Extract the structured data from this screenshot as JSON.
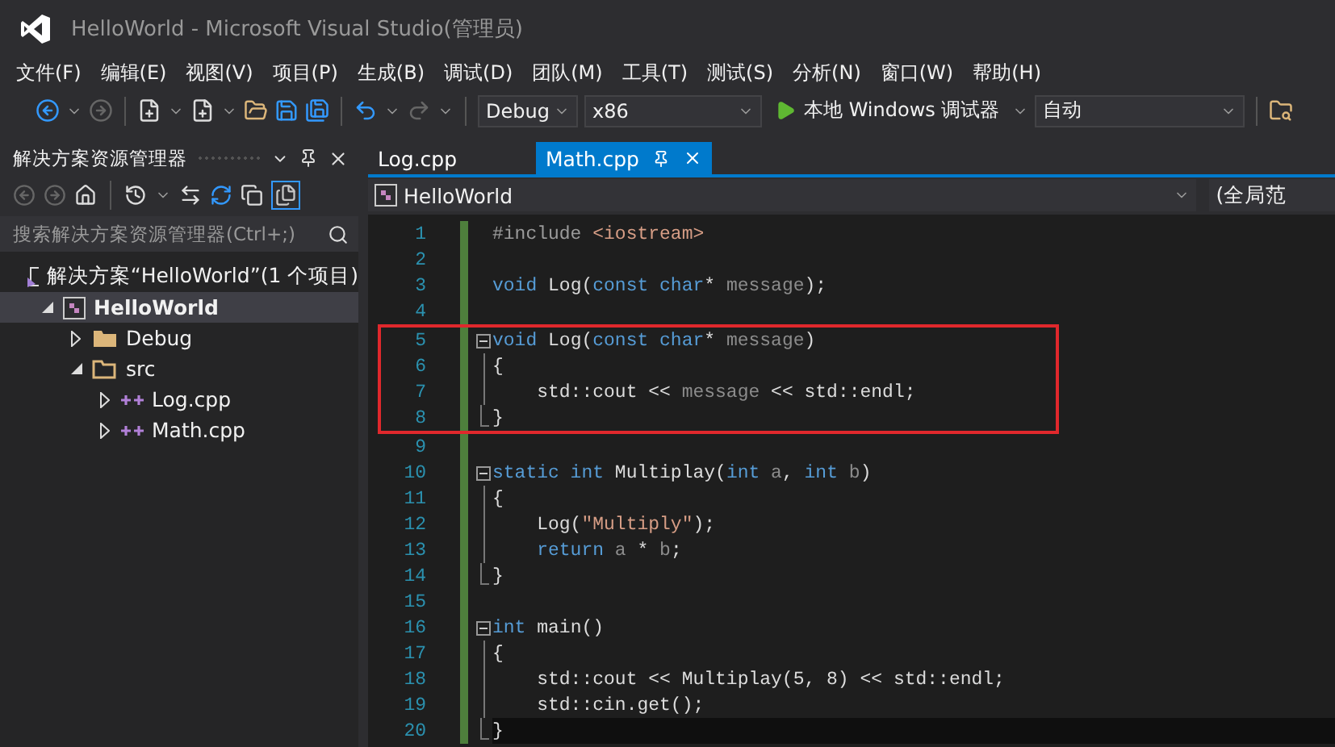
{
  "window": {
    "title": "HelloWorld - Microsoft Visual Studio(管理员)"
  },
  "menu": [
    "文件(F)",
    "编辑(E)",
    "视图(V)",
    "项目(P)",
    "生成(B)",
    "调试(D)",
    "团队(M)",
    "工具(T)",
    "测试(S)",
    "分析(N)",
    "窗口(W)",
    "帮助(H)"
  ],
  "toolbar": {
    "configuration": "Debug",
    "platform": "x86",
    "run_button": "本地 Windows 调试器",
    "mode": "自动"
  },
  "solution_explorer": {
    "title": "解决方案资源管理器",
    "search": {
      "placeholder": "搜索解决方案资源管理器(Ctrl+;)"
    },
    "tree": [
      {
        "label": "解决方案“HelloWorld”(1 个项目)",
        "kind": "solution",
        "selected": false,
        "children": [
          {
            "label": "HelloWorld",
            "kind": "project",
            "expanded": true,
            "selected": true,
            "children": [
              {
                "label": "Debug",
                "kind": "folder",
                "expanded": false,
                "selected": false
              },
              {
                "label": "src",
                "kind": "folder",
                "expanded": true,
                "selected": false,
                "children": [
                  {
                    "label": "Log.cpp",
                    "kind": "file",
                    "expanded": false,
                    "selected": false
                  },
                  {
                    "label": "Math.cpp",
                    "kind": "file",
                    "expanded": false,
                    "selected": false
                  }
                ]
              }
            ]
          }
        ]
      }
    ]
  },
  "tabs": [
    {
      "label": "Log.cpp",
      "selected": false
    },
    {
      "label": "Math.cpp",
      "selected": true
    }
  ],
  "nav_bar": {
    "project": "HelloWorld",
    "scope": "(全局范"
  },
  "editor": {
    "lines": [
      {
        "number": "1",
        "highlight": false,
        "current": false,
        "tokens": [
          {
            "text": "#include ",
            "kind": "directive"
          },
          {
            "text": "<iostream>",
            "kind": "string"
          }
        ]
      },
      {
        "number": "2",
        "highlight": false,
        "current": false
      },
      {
        "number": "3",
        "highlight": false,
        "current": false,
        "tokens": [
          {
            "text": "void",
            "kind": "keyword"
          },
          {
            "text": " Log(",
            "kind": "plain"
          },
          {
            "text": "const char",
            "kind": "keyword"
          },
          {
            "text": "* ",
            "kind": "plain"
          },
          {
            "text": "message",
            "kind": "param"
          },
          {
            "text": ");",
            "kind": "plain"
          }
        ]
      },
      {
        "number": "4",
        "highlight": false,
        "current": false
      },
      {
        "number": "5",
        "fold": {
          "kind": "open"
        },
        "highlight": true,
        "current": false,
        "tokens": [
          {
            "text": "void",
            "kind": "keyword"
          },
          {
            "text": " Log(",
            "kind": "plain"
          },
          {
            "text": "const char",
            "kind": "keyword"
          },
          {
            "text": "* ",
            "kind": "plain"
          },
          {
            "text": "message",
            "kind": "param"
          },
          {
            "text": ")",
            "kind": "plain"
          }
        ]
      },
      {
        "number": "6",
        "fold": {
          "kind": "inner"
        },
        "highlight": true,
        "current": false,
        "tokens": [
          {
            "text": "{",
            "kind": "plain"
          }
        ]
      },
      {
        "number": "7",
        "fold": {
          "kind": "inner"
        },
        "highlight": true,
        "current": false,
        "tokens": [
          {
            "text": "    std::cout << ",
            "kind": "plain"
          },
          {
            "text": "message",
            "kind": "param"
          },
          {
            "text": " << std::endl;",
            "kind": "plain"
          }
        ]
      },
      {
        "number": "8",
        "fold": {
          "kind": "close"
        },
        "highlight": true,
        "current": false,
        "tokens": [
          {
            "text": "}",
            "kind": "plain"
          }
        ]
      },
      {
        "number": "9",
        "highlight": false,
        "current": false
      },
      {
        "number": "10",
        "fold": {
          "kind": "open"
        },
        "highlight": false,
        "current": false,
        "tokens": [
          {
            "text": "static int",
            "kind": "keyword"
          },
          {
            "text": " Multiplay(",
            "kind": "plain"
          },
          {
            "text": "int",
            "kind": "keyword"
          },
          {
            "text": " a",
            "kind": "param"
          },
          {
            "text": ", ",
            "kind": "plain"
          },
          {
            "text": "int",
            "kind": "keyword"
          },
          {
            "text": " b",
            "kind": "param"
          },
          {
            "text": ")",
            "kind": "plain"
          }
        ]
      },
      {
        "number": "11",
        "fold": {
          "kind": "inner"
        },
        "highlight": false,
        "current": false,
        "tokens": [
          {
            "text": "{",
            "kind": "plain"
          }
        ]
      },
      {
        "number": "12",
        "fold": {
          "kind": "inner"
        },
        "highlight": false,
        "current": false,
        "tokens": [
          {
            "text": "    Log(",
            "kind": "plain"
          },
          {
            "text": "\"Multiply\"",
            "kind": "string"
          },
          {
            "text": ");",
            "kind": "plain"
          }
        ]
      },
      {
        "number": "13",
        "fold": {
          "kind": "inner"
        },
        "highlight": false,
        "current": false,
        "tokens": [
          {
            "text": "    return",
            "kind": "keyword"
          },
          {
            "text": " a",
            "kind": "param"
          },
          {
            "text": " * ",
            "kind": "plain"
          },
          {
            "text": "b",
            "kind": "param"
          },
          {
            "text": ";",
            "kind": "plain"
          }
        ]
      },
      {
        "number": "14",
        "fold": {
          "kind": "close"
        },
        "highlight": false,
        "current": false,
        "tokens": [
          {
            "text": "}",
            "kind": "plain"
          }
        ]
      },
      {
        "number": "15",
        "highlight": false,
        "current": false
      },
      {
        "number": "16",
        "fold": {
          "kind": "open"
        },
        "highlight": false,
        "current": false,
        "tokens": [
          {
            "text": "int",
            "kind": "keyword"
          },
          {
            "text": " main()",
            "kind": "plain"
          }
        ]
      },
      {
        "number": "17",
        "fold": {
          "kind": "inner"
        },
        "highlight": false,
        "current": false,
        "tokens": [
          {
            "text": "{",
            "kind": "plain"
          }
        ]
      },
      {
        "number": "18",
        "fold": {
          "kind": "inner"
        },
        "highlight": false,
        "current": false,
        "tokens": [
          {
            "text": "    std::cout << Multiplay(5, 8) << std::endl;",
            "kind": "plain"
          }
        ]
      },
      {
        "number": "19",
        "fold": {
          "kind": "inner"
        },
        "highlight": false,
        "current": false,
        "tokens": [
          {
            "text": "    std::cin.get();",
            "kind": "plain"
          }
        ]
      },
      {
        "number": "20",
        "fold": {
          "kind": "close"
        },
        "highlight": false,
        "current": true,
        "tokens": [
          {
            "text": "}",
            "kind": "plain"
          }
        ]
      }
    ]
  }
}
